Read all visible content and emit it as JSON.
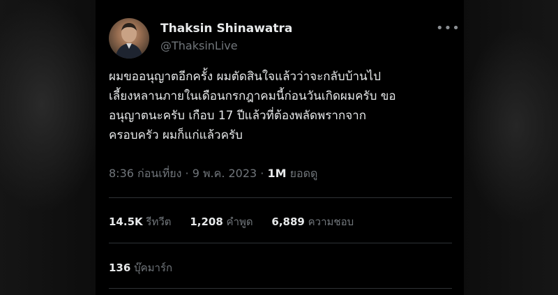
{
  "author": {
    "name": "Thaksin Shinawatra",
    "handle": "@ThaksinLive"
  },
  "more_icon": "more-horizontal-icon",
  "tweet": {
    "lines": [
      "ผมขออนุญาตอีกครั้ง ผมตัดสินใจแล้วว่าจะกลับบ้านไป",
      "เลี้ยงหลานภายในเดือนกรกฎาคมนี้ก่อนวันเกิดผมครับ ขอ",
      "อนุญาตนะครับ เกือบ 17 ปีแล้วที่ต้องพลัดพรากจาก",
      "ครอบครัว ผมก็แก่แล้วครับ"
    ]
  },
  "meta": {
    "time": "8:36 ก่อนเที่ยง",
    "sep1": " · ",
    "date": "9 พ.ค. 2023",
    "sep2": " · ",
    "views_count": "1M",
    "views_label": " ยอดดู"
  },
  "stats": {
    "retweets_count": "14.5K",
    "retweets_label": " รีทวีต",
    "quotes_count": "1,208",
    "quotes_label": " คำพูด",
    "likes_count": "6,889",
    "likes_label": " ความชอบ"
  },
  "bookmarks": {
    "count": "136",
    "label": " บุ๊คมาร์ก"
  },
  "colors": {
    "background": "#000000",
    "text_primary": "#e7e9ea",
    "text_secondary": "#71767b",
    "divider": "#2f3336"
  }
}
